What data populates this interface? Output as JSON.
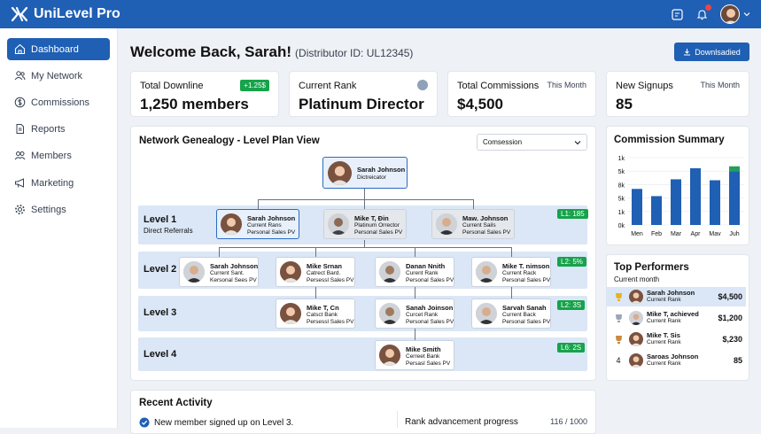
{
  "app": {
    "name": "UniLevel Pro"
  },
  "sidebar": {
    "items": [
      {
        "label": "Dashboard",
        "icon": "home-icon",
        "active": true
      },
      {
        "label": "My Network",
        "icon": "users-icon"
      },
      {
        "label": "Commissions",
        "icon": "dollar-icon"
      },
      {
        "label": "Reports",
        "icon": "document-icon"
      },
      {
        "label": "Members",
        "icon": "people-icon"
      },
      {
        "label": "Marketing",
        "icon": "megaphone-icon"
      },
      {
        "label": "Settings",
        "icon": "gear-icon"
      }
    ]
  },
  "header": {
    "welcome": "Welcome Back, Sarah!",
    "distributor": "(Distributor ID: UL12345)",
    "download_label": "Downlsadied"
  },
  "stats": [
    {
      "label": "Total Downline",
      "value": "1,250 members",
      "badge": "+1.25$"
    },
    {
      "label": "Current Rank",
      "value": "Platinum Director"
    },
    {
      "label": "Total Commissions",
      "value": "$4,500",
      "side": "This Month"
    },
    {
      "label": "New Signups",
      "value": "85",
      "side": "This Month"
    }
  ],
  "genealogy": {
    "title": "Network Genealogy - Level Plan View",
    "select_value": "Comsession",
    "root": {
      "name": "Sarah Johnson",
      "l2": "Dictreicator"
    },
    "levels": [
      {
        "label": "Level 1",
        "sub": "Direct Referrals",
        "pill": "L1: 185"
      },
      {
        "label": "Level 2",
        "pill": "L2: 5%"
      },
      {
        "label": "Level 3",
        "pill": "L2: 3S"
      },
      {
        "label": "Level 4",
        "pill": "L6: 2S"
      }
    ],
    "nodes": {
      "l1": [
        {
          "name": "Sarah Johnson",
          "l2": "Current Rans",
          "l3": "Personal Sales PV"
        },
        {
          "name": "Mike T, Đin",
          "l2": "Platinum Orrector",
          "l3": "Personal Sales PV"
        },
        {
          "name": "Maw. Johnson",
          "l2": "Current Sails",
          "l3": "Personal Sales PV"
        }
      ],
      "l2": [
        {
          "name": "Sarah Johnson",
          "l2": "Current Sant.",
          "l3": "Kersonal Sees PV"
        },
        {
          "name": "Mike Srnan",
          "l2": "Catrect Bard.",
          "l3": "Persessl Sales PV"
        },
        {
          "name": "Danan Nnith",
          "l2": "Curent Rank",
          "l3": "Personal Sales PV"
        },
        {
          "name": "Mike T. nimson",
          "l2": "Current Rack",
          "l3": "Personal Sales PV"
        }
      ],
      "l3": [
        {
          "name": "Mike T, Cn",
          "l2": "Catsct Bank",
          "l3": "Persessl Sales PV"
        },
        {
          "name": "Sanah Joinson",
          "l2": "Curcet Rank",
          "l3": "Personal Sales PV"
        },
        {
          "name": "Sarvah Sanah",
          "l2": "Current Back",
          "l3": "Personal Sales PV"
        }
      ],
      "l4": [
        {
          "name": "Mike Smith",
          "l2": "Cerreet Bank",
          "l3": "Persasl Sales PV"
        }
      ]
    }
  },
  "commission_summary": {
    "title": "Commission Summary",
    "chart_data": {
      "type": "bar",
      "categories": [
        "Men",
        "Feb",
        "Mar",
        "Apr",
        "Mav",
        "Juh"
      ],
      "values": [
        7500,
        6000,
        9500,
        11800,
        9300,
        11200
      ],
      "stack_top": [
        0,
        0,
        0,
        0,
        0,
        1000
      ],
      "ytick_labels": [
        "1k",
        "5k",
        "8k",
        "5k",
        "1k",
        "0k"
      ],
      "ylim": [
        0,
        14000
      ],
      "colors": {
        "main": "#1f5fb4",
        "top": "#22a05a"
      }
    }
  },
  "top_performers": {
    "title": "Top Performers",
    "sub": "Current month",
    "rows": [
      {
        "rank_icon": "gold-trophy-icon",
        "name": "Sarah Johnson",
        "sub": "Current Rank",
        "value": "$4,500"
      },
      {
        "rank_icon": "silver-trophy-icon",
        "name": "Mike T, achieved",
        "sub": "Current Rank",
        "value": "$1,200"
      },
      {
        "rank_icon": "bronze-trophy-icon",
        "name": "Mike T. Sis",
        "sub": "Current Rank",
        "value": "$,230"
      },
      {
        "rank": "4",
        "name": "Saroas Johnson",
        "sub": "Current Rank",
        "value": "85"
      }
    ]
  },
  "recent_activity": {
    "title": "Recent Activity",
    "item": "New member signed up on Level 3.",
    "progress_label": "Rank advancement progress",
    "progress_value": "116 / 1000"
  }
}
